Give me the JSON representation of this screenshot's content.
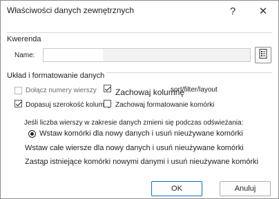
{
  "window": {
    "title": "Właściwości danych zewnętrznych",
    "help_glyph": "?",
    "close_glyph": "✕"
  },
  "query": {
    "section_label": "Kwerenda",
    "name_label": "Name:",
    "name_value": "",
    "properties_icon": "properties-icon"
  },
  "layout": {
    "section_label": "Układ i formatowanie danych",
    "options": [
      {
        "label": "Dołącz numery wierszy",
        "checked": false,
        "enabled": false
      },
      {
        "label": "Zachowaj kolumnę",
        "checked": true,
        "enabled": true
      },
      {
        "label": "Dopasuj szerokość kolumny",
        "checked": true,
        "enabled": true
      },
      {
        "label": "Zachowaj formatowanie komórki",
        "checked": false,
        "enabled": true
      }
    ],
    "overlay_text": "sort/filter/layout"
  },
  "refresh": {
    "question": "Jeśli liczba wierszy w zakresie danych zmieni się podczas odświeżania:",
    "options": [
      {
        "label": "Wstaw komórki dla nowy danych i usuń nieużywane komórki",
        "selected": true
      },
      {
        "label": "Wstaw całe wiersze dla nowy danych i usuń nieużywane komórki",
        "selected": false
      },
      {
        "label": "Zastąp istniejące komórki nowymi danymi i usuń nieużywane komórki",
        "selected": false
      }
    ]
  },
  "buttons": {
    "ok": "OK",
    "cancel": "Anuluj"
  }
}
